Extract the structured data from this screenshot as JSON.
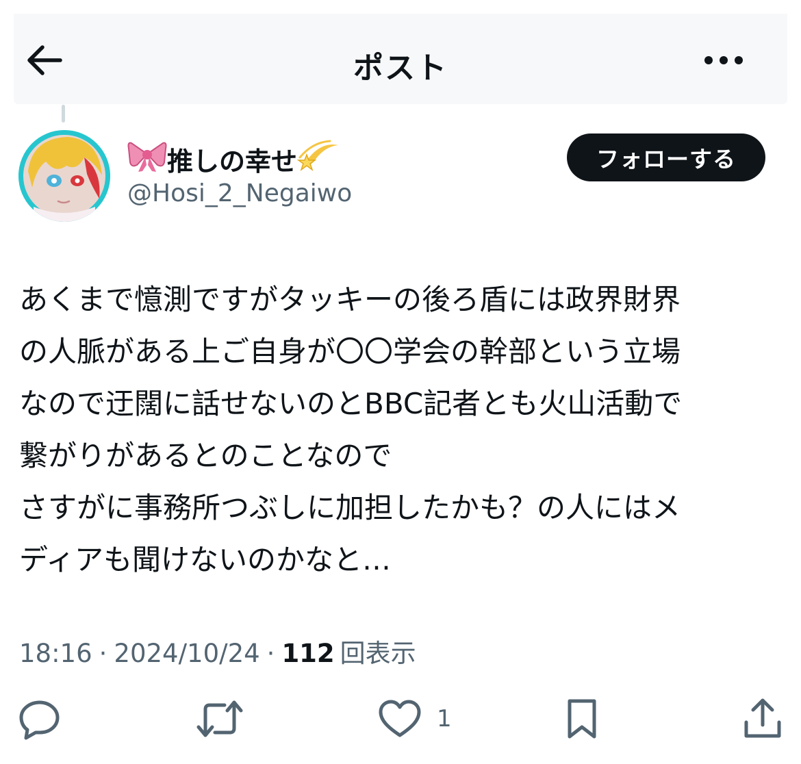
{
  "header": {
    "title": "ポスト",
    "back_icon": "arrow-left-icon",
    "more_icon": "more-horizontal-icon"
  },
  "author": {
    "prefix_emoji": "🎀",
    "display_name": "推しの幸せ",
    "suffix_emoji": "💫",
    "handle": "@Hosi_2_Negaiwo",
    "avatar_ring_color": "#27c6cf"
  },
  "follow_button": {
    "label": "フォローする"
  },
  "post": {
    "lines": [
      "あくまで憶測ですがタッキーの後ろ盾には政界財界",
      "の人脈がある上ご自身が〇〇学会の幹部という立場",
      "なので迂闊に話せないのとBBC記者とも火山活動で",
      "繋がりがあるとのことなので",
      "さすがに事務所つぶしに加担したかも？の人にはメ",
      "ディアも聞けないのかなと…"
    ]
  },
  "meta": {
    "time": "18:16",
    "separator": "·",
    "date": "2024/10/24",
    "views_count": "112",
    "views_label": "回表示"
  },
  "actions": {
    "reply_icon": "reply-icon",
    "repost_icon": "repost-icon",
    "like_icon": "heart-icon",
    "like_count": "1",
    "bookmark_icon": "bookmark-icon",
    "share_icon": "share-icon"
  },
  "colors": {
    "text": "#0f1419",
    "secondary_text": "#536471",
    "header_bg": "#f7f8f9",
    "button_bg": "#0f1419"
  }
}
